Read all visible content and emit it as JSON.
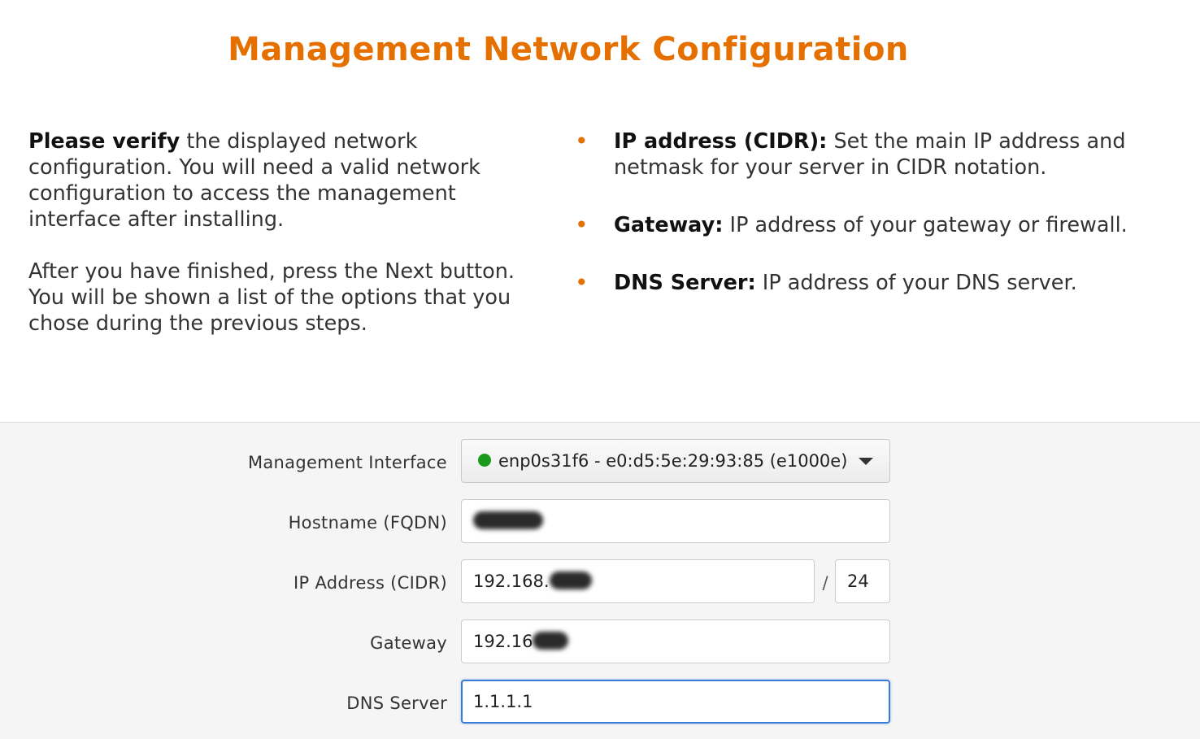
{
  "header": {
    "title": "Management Network Configuration"
  },
  "intro": {
    "para1_bold": "Please verify",
    "para1_rest": " the displayed network configuration. You will need a valid network configuration to access the management interface after installing.",
    "para2": "After you have finished, press the Next button. You will be shown a list of the options that you chose during the previous steps."
  },
  "help": {
    "items": [
      {
        "term": "IP address (CIDR):",
        "desc": " Set the main IP address and netmask for your server in CIDR notation."
      },
      {
        "term": "Gateway:",
        "desc": " IP address of your gateway or firewall."
      },
      {
        "term": "DNS Server:",
        "desc": " IP address of your DNS server."
      }
    ]
  },
  "form": {
    "management_interface": {
      "label": "Management Interface",
      "value": "enp0s31f6 - e0:d5:5e:29:93:85 (e1000e)",
      "status_color": "#1a9a1a"
    },
    "hostname": {
      "label": "Hostname (FQDN)",
      "value": ""
    },
    "ip_address": {
      "label": "IP Address (CIDR)",
      "value": "192.168.",
      "separator": "/",
      "prefix": "24"
    },
    "gateway": {
      "label": "Gateway",
      "value": "192.16"
    },
    "dns_server": {
      "label": "DNS Server",
      "value": "1.1.1.1"
    }
  },
  "colors": {
    "accent": "#e57000",
    "focus": "#3a7bd5"
  },
  "icons": {
    "bullet": "•",
    "status_dot": "status-dot-icon",
    "dropdown": "chevron-down-icon"
  }
}
